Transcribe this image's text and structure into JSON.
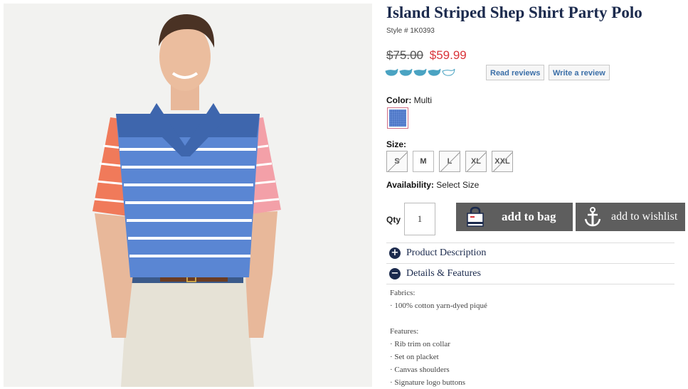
{
  "product": {
    "title": "Island Striped Shep Shirt Party Polo",
    "style": "Style # 1K0393",
    "price_old": "$75.00",
    "price_new": "$59.99",
    "rating": 4,
    "rating_max": 5,
    "read_reviews": "Read reviews",
    "write_review": "Write a review"
  },
  "color": {
    "label": "Color:",
    "value": "Multi",
    "swatch": "#4f78c7"
  },
  "size": {
    "label": "Size:",
    "options": [
      "S",
      "M",
      "L",
      "XL",
      "XXL"
    ],
    "available": [
      false,
      true,
      false,
      false,
      false
    ]
  },
  "availability": {
    "label": "Availability:",
    "value": "Select Size"
  },
  "qty": {
    "label": "Qty",
    "value": "1"
  },
  "actions": {
    "add_to_bag": "add to bag",
    "add_to_wishlist": "add to wishlist"
  },
  "accordion": {
    "description": "Product Description",
    "details": "Details & Features"
  },
  "details": {
    "fabrics_label": "Fabrics:",
    "fabrics": [
      "· 100% cotton yarn-dyed piqué"
    ],
    "features_label": "Features:",
    "features": [
      "· Rib trim on collar",
      "· Set on placket",
      "· Canvas shoulders",
      "· Signature logo buttons"
    ]
  },
  "colors": {
    "navy": "#1b2a4d",
    "sale": "#d9343a",
    "whale": "#4aa3c2",
    "button": "#5e5e5e"
  }
}
